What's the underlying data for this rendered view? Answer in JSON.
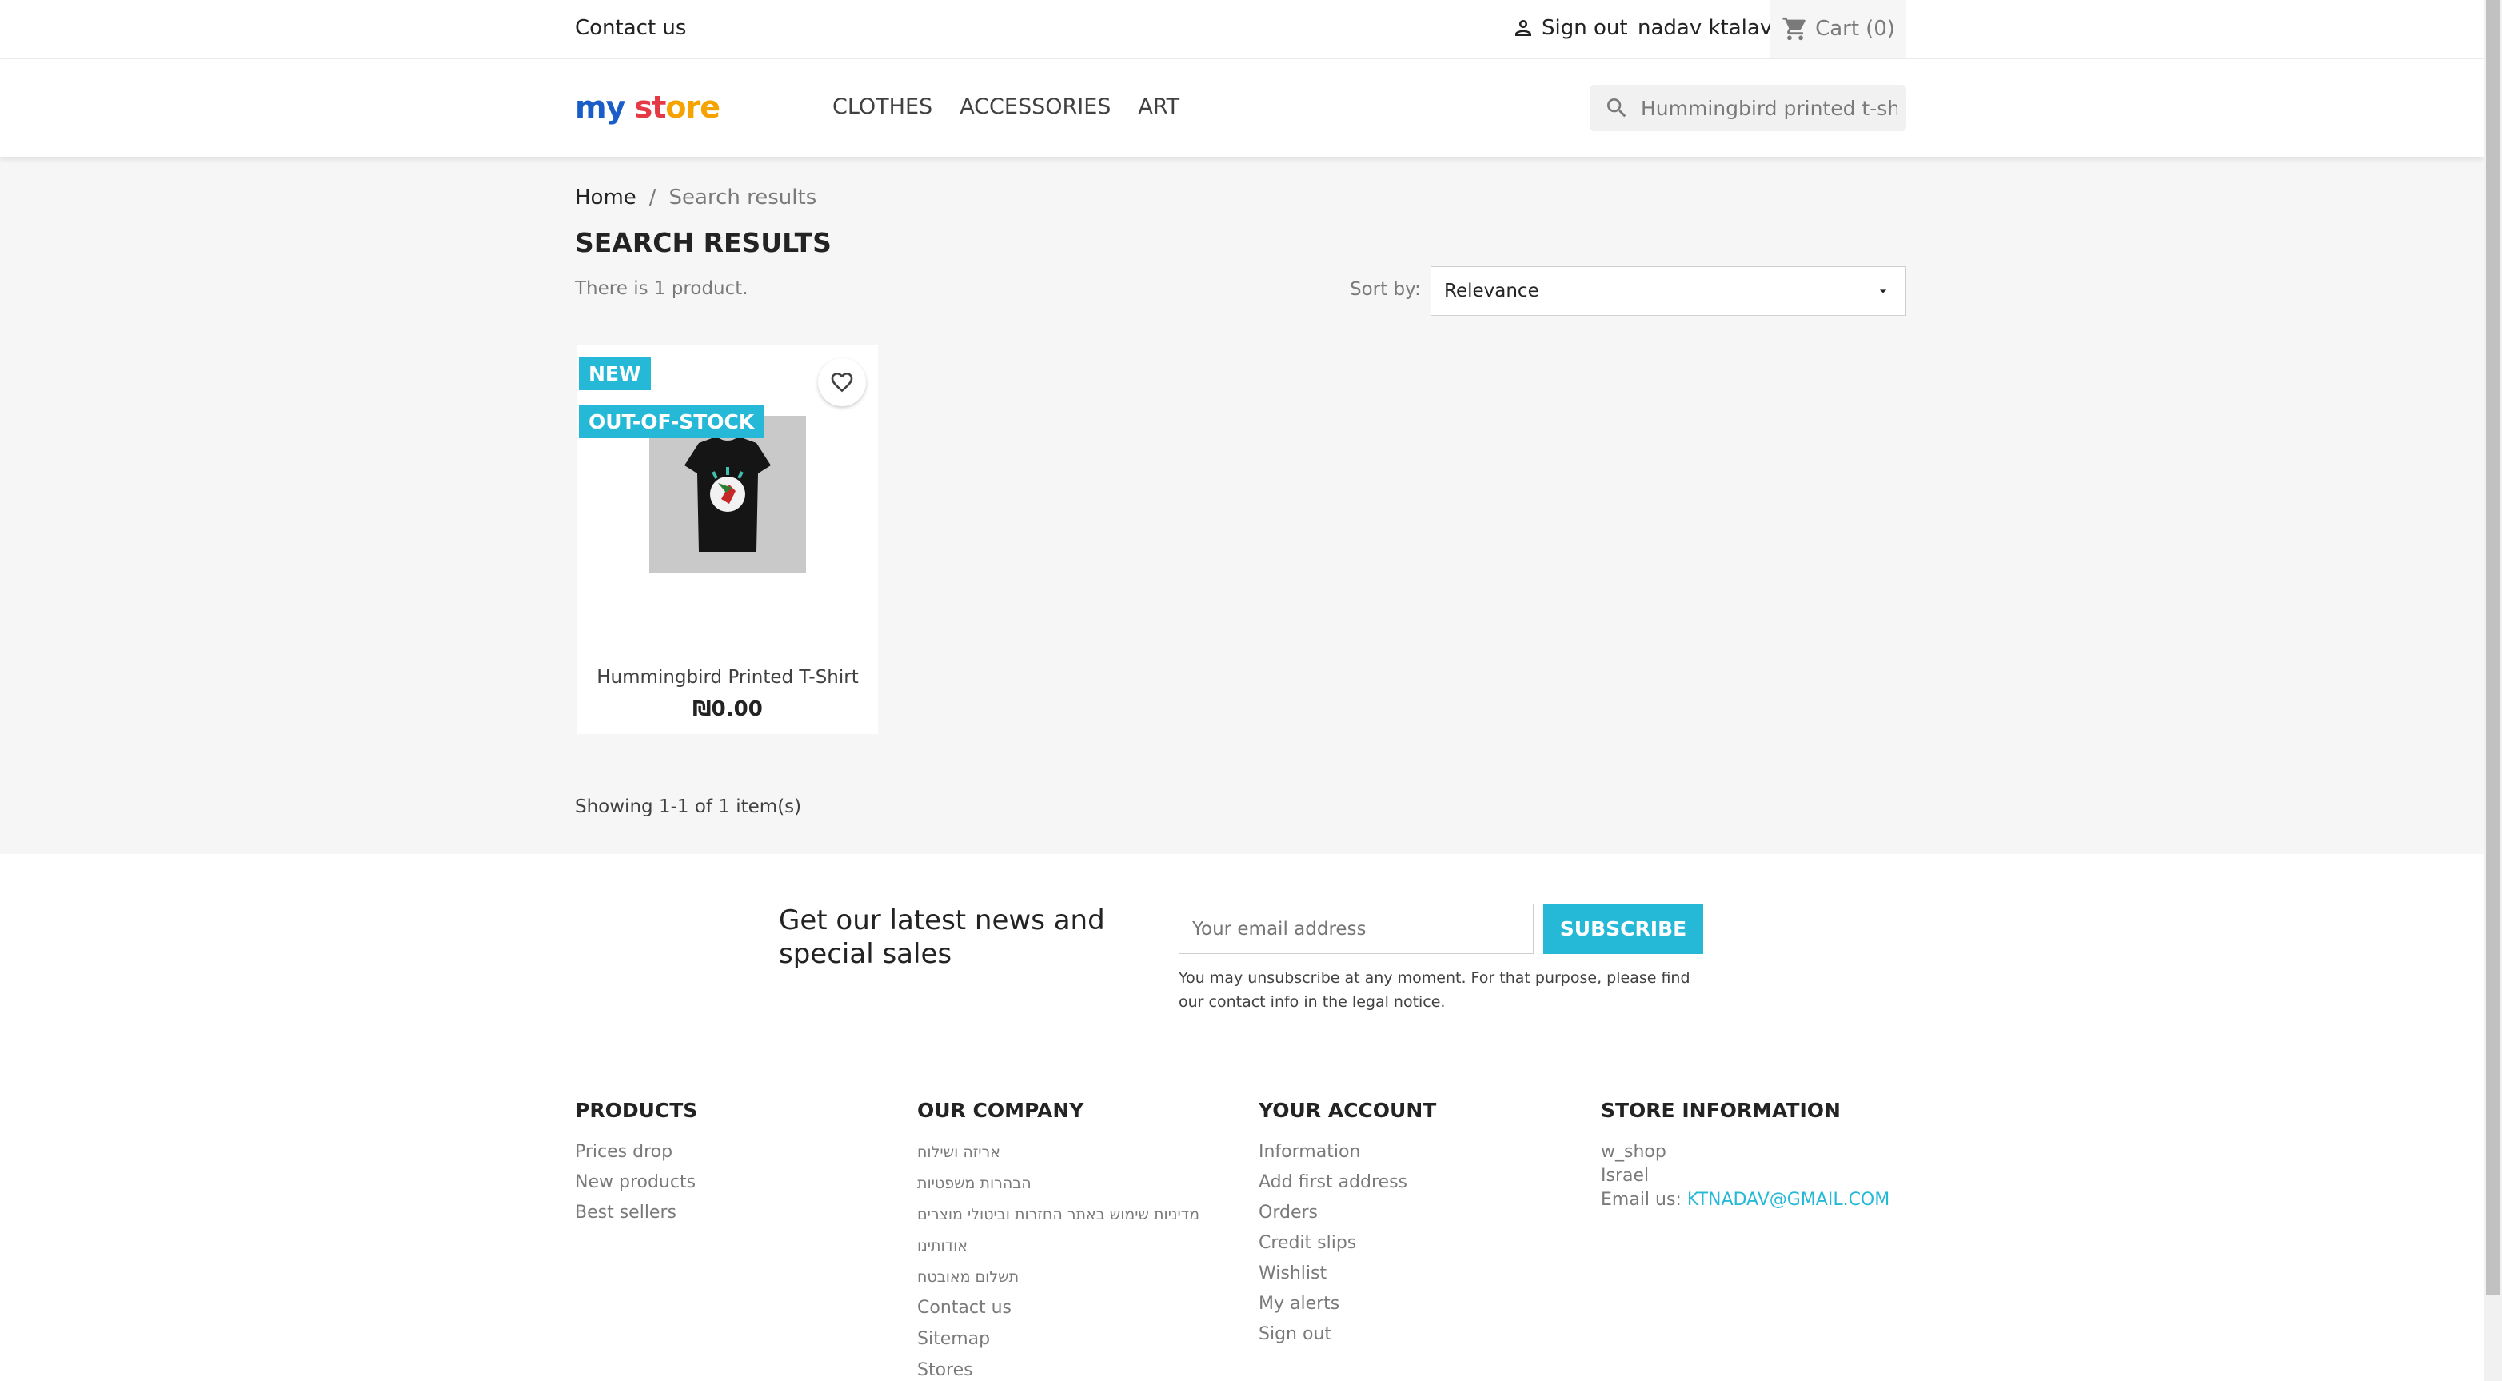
{
  "topbar": {
    "contact": "Contact us",
    "signout": "Sign out",
    "username": "nadav ktalav",
    "cart_label": "Cart",
    "cart_count": "(0)"
  },
  "header": {
    "logo_parts": [
      "my",
      " ",
      "st",
      "ore"
    ],
    "nav": [
      "CLOTHES",
      "ACCESSORIES",
      "ART"
    ],
    "search_value": "Hummingbird printed t-shirt"
  },
  "content": {
    "breadcrumb": [
      "Home",
      "/",
      "Search results"
    ],
    "title": "SEARCH RESULTS",
    "count_text": "There is 1 product.",
    "sort_label": "Sort by:",
    "sort_value": "Relevance",
    "showing": "Showing 1-1 of 1 item(s)"
  },
  "product": {
    "badge_new": "NEW",
    "badge_oos": "OUT-OF-STOCK",
    "name": "Hummingbird Printed T-Shirt",
    "price": "₪0.00"
  },
  "newsletter": {
    "title": "Get our latest news and special sales",
    "placeholder": "Your email address",
    "button": "SUBSCRIBE",
    "note": "You may unsubscribe at any moment. For that purpose, please find our contact info in the legal notice."
  },
  "footer": {
    "products_title": "PRODUCTS",
    "products": [
      "Prices drop",
      "New products",
      "Best sellers"
    ],
    "company_title": "OUR COMPANY",
    "company": [
      "אריזה ושילוח",
      "הבהרות משפטיות",
      "מדיניות שימוש באתר החזרות וביטולי מוצרים",
      "אודותינו",
      "תשלום מאובטח",
      "Contact us",
      "Sitemap",
      "Stores"
    ],
    "account_title": "YOUR ACCOUNT",
    "account": [
      "Information",
      "Add first address",
      "Orders",
      "Credit slips",
      "Wishlist",
      "My alerts",
      "Sign out"
    ],
    "store_title": "STORE INFORMATION",
    "store_name": "w_shop",
    "store_country": "Israel",
    "email_label": "Email us: ",
    "email": "KTNADAV@GMAIL.COM"
  },
  "colors": {
    "accent": "#25b9d7",
    "text": "#232323",
    "muted": "#7a7a7a",
    "background": "#f6f6f6"
  },
  "icons": {
    "account": "person-icon",
    "cart": "cart-icon",
    "search": "search-icon",
    "sort": "caret-down-icon",
    "wishlist": "heart-outline-icon"
  }
}
